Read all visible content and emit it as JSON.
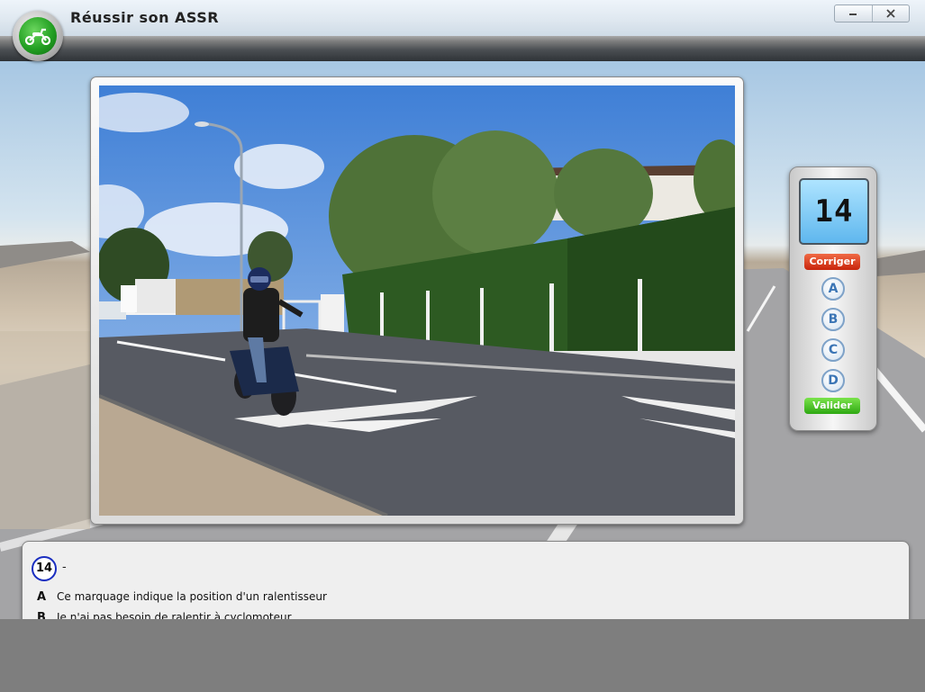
{
  "window": {
    "title": "Réussir son ASSR",
    "controls": {
      "minimize": "—",
      "close": "✕"
    }
  },
  "icons": {
    "logo": "scooter-icon",
    "minimize": "minimize-icon",
    "close": "close-icon"
  },
  "panel": {
    "question_number": "14",
    "corriger_label": "Corriger",
    "options": [
      "A",
      "B",
      "C",
      "D"
    ],
    "valider_label": "Valider"
  },
  "question": {
    "number": "14",
    "text": "-",
    "answers": [
      {
        "letter": "A",
        "text": "Ce marquage indique la position d'un ralentisseur"
      },
      {
        "letter": "B",
        "text": "Je n'ai pas besoin de ralentir à cyclomoteur"
      }
    ]
  },
  "colors": {
    "corriger": "#d8361a",
    "valider": "#3fc21d",
    "display": "#7cc8f3",
    "badge_border": "#1a2ec0"
  }
}
